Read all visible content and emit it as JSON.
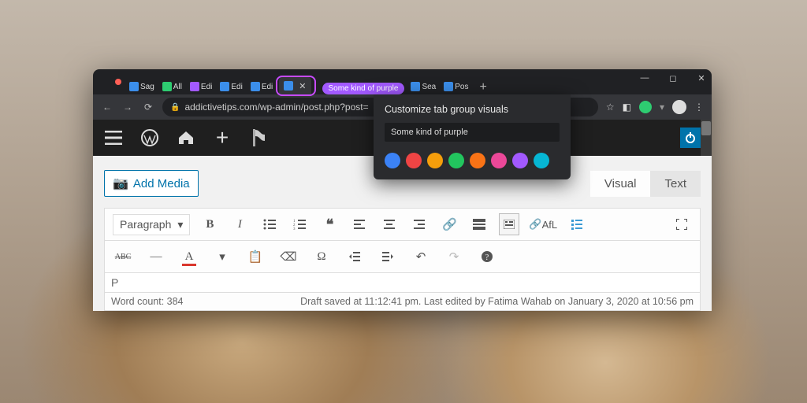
{
  "window": {
    "url": "addictivetips.com/wp-admin/post.php?post="
  },
  "tabs": {
    "t0": "Sag",
    "t1": "All",
    "t2": "Edi",
    "t3": "Edi",
    "t4": "Edi",
    "active": "",
    "group_chip": "Some kind of purple",
    "t5": "Sea",
    "t6": "Pos"
  },
  "popup": {
    "title": "Customize tab group visuals",
    "value": "Some kind of purple",
    "colors": [
      "#3b82f6",
      "#ef4444",
      "#f59e0b",
      "#22c55e",
      "#f97316",
      "#ec4899",
      "#a259ff",
      "#06b6d4"
    ]
  },
  "editor": {
    "add_media": "Add Media",
    "tab_visual": "Visual",
    "tab_text": "Text",
    "paragraph": "Paragraph",
    "bold": "B",
    "italic": "I",
    "afl": "AfL",
    "abc": "ABC",
    "letter_a": "A",
    "omega": "Ω",
    "path_crumb": "P",
    "word_count": "Word count: 384",
    "draft_status": "Draft saved at 11:12:41 pm. Last edited by Fatima Wahab on January 3, 2020 at 10:56 pm"
  }
}
